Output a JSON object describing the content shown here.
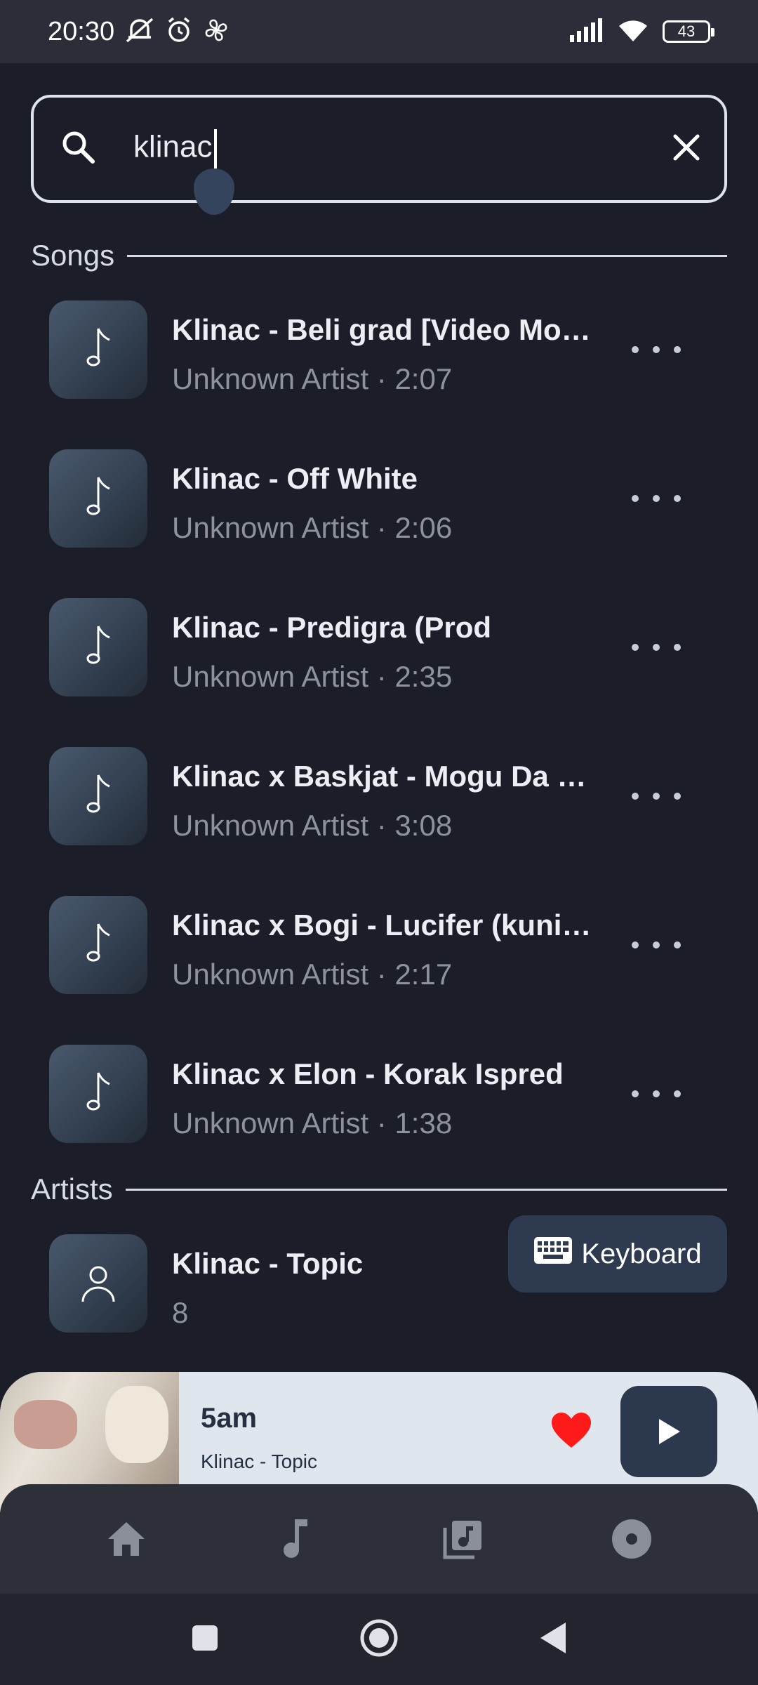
{
  "status_bar": {
    "time": "20:30",
    "battery": "43",
    "icons": [
      "mute-icon",
      "alarm-icon",
      "fan-icon",
      "signal-icon",
      "wifi-icon",
      "battery-icon"
    ]
  },
  "search": {
    "value": "klinac",
    "icon": "search-icon",
    "clear_icon": "close-icon"
  },
  "sections": {
    "songs": "Songs",
    "artists": "Artists"
  },
  "songs": [
    {
      "title": "Klinac - Beli grad [Video Mo…",
      "subtitle": "Unknown Artist · 2:07"
    },
    {
      "title": "Klinac - Off White",
      "subtitle": "Unknown Artist · 2:06"
    },
    {
      "title": "Klinac - Predigra (Prod",
      "subtitle": "Unknown Artist · 2:35"
    },
    {
      "title": "Klinac x Baskjat - Mogu Da …",
      "subtitle": "Unknown Artist · 3:08"
    },
    {
      "title": "Klinac x Bogi - Lucifer (kuni…",
      "subtitle": "Unknown Artist · 2:17"
    },
    {
      "title": "Klinac x Elon - Korak Ispred",
      "subtitle": "Unknown Artist · 1:38"
    }
  ],
  "artists": [
    {
      "name": "Klinac - Topic",
      "count": "8"
    }
  ],
  "keyboard_button": {
    "label": "Keyboard"
  },
  "now_playing": {
    "title": "5am",
    "artist": "Klinac - Topic",
    "liked": true
  },
  "bottom_nav": [
    "home-icon",
    "music-note-icon",
    "library-icon",
    "disc-icon"
  ],
  "colors": {
    "background": "#1b1e28",
    "accent": "#2b384d",
    "heart": "#ff1a1a",
    "mini_player_bg": "#e0e6ee"
  }
}
